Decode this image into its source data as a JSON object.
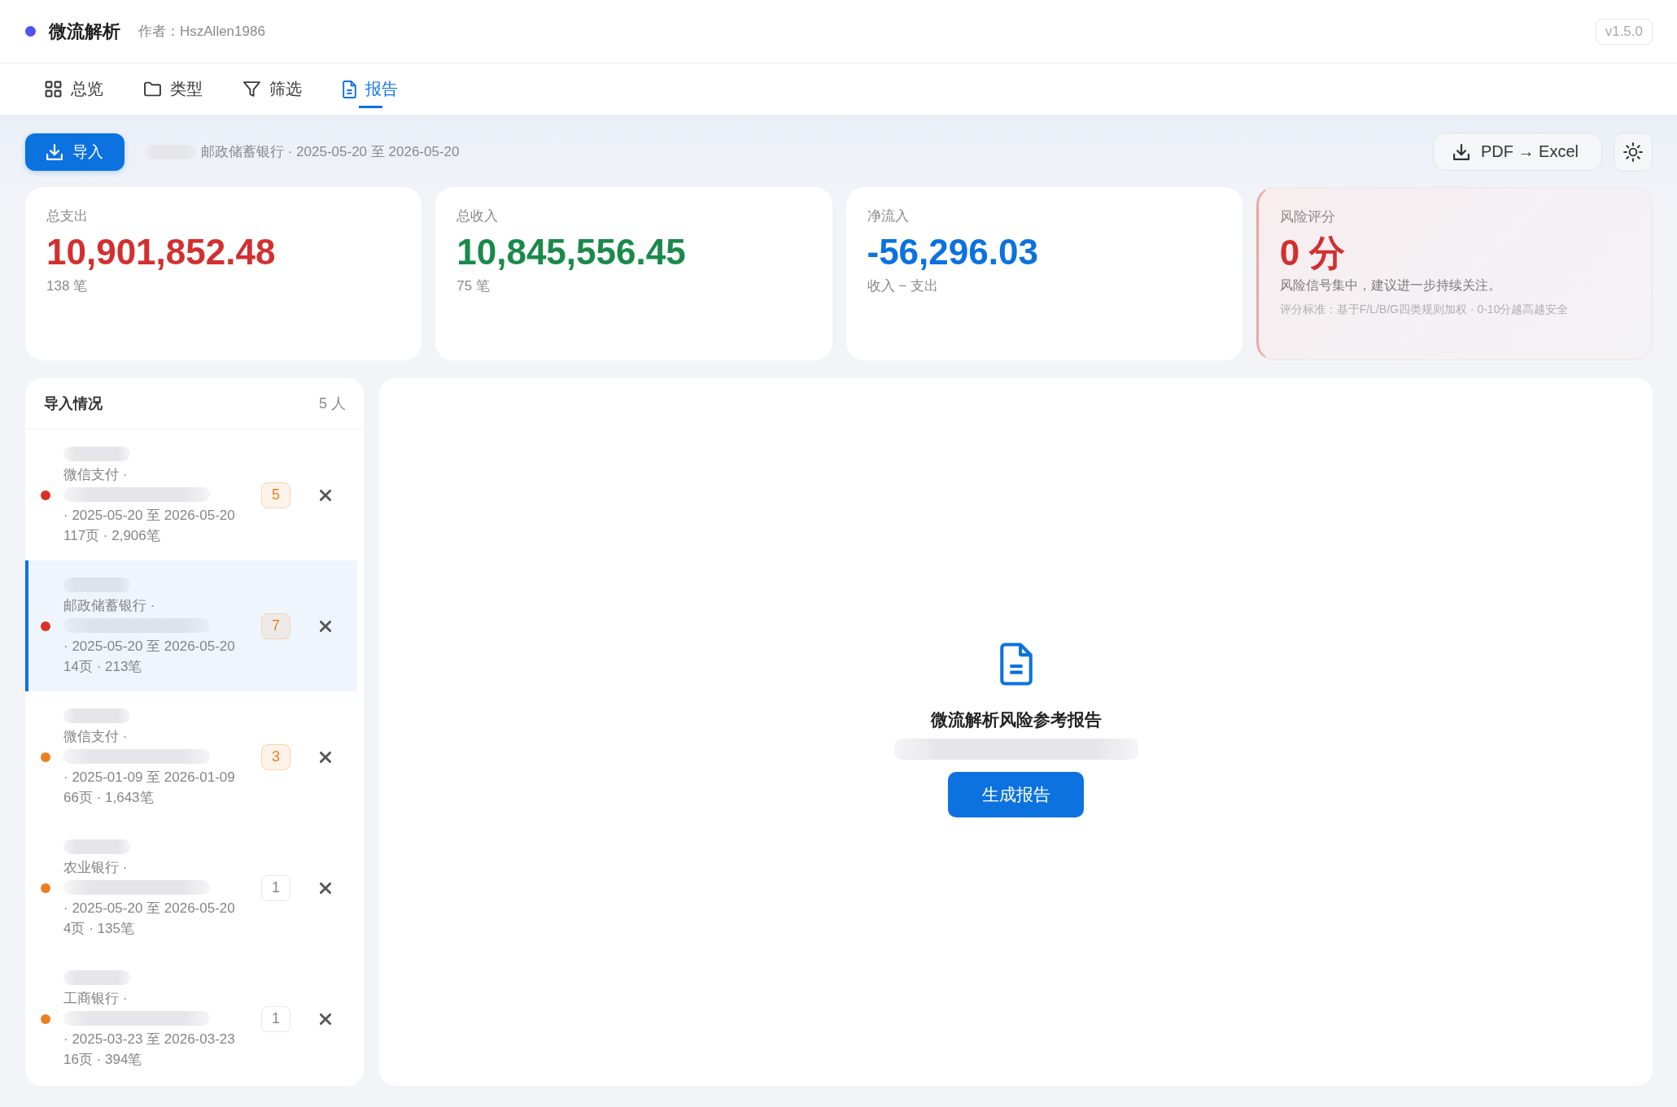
{
  "header": {
    "title": "微流解析",
    "author": "作者：HszAllen1986",
    "version": "v1.5.0"
  },
  "tabs": [
    {
      "label": "总览",
      "selected": false
    },
    {
      "label": "类型",
      "selected": false
    },
    {
      "label": "筛选",
      "selected": false
    },
    {
      "label": "报告",
      "selected": true
    }
  ],
  "toolbar": {
    "import_button": "导入",
    "current_file": "邮政储蓄银行 · 2025-05-20 至 2026-05-20",
    "convert_button": "PDF → Excel"
  },
  "stats": [
    {
      "kind": "amount",
      "label": "总支出",
      "value": "10,901,852.48",
      "color": "#d32f2f",
      "note": "138 笔"
    },
    {
      "kind": "amount",
      "label": "总收入",
      "value": "10,845,556.45",
      "color": "#1a8a4a",
      "note": "75 笔"
    },
    {
      "kind": "amount",
      "label": "净流入",
      "value": "-56,296.03",
      "color": "#0b72e0",
      "note": "收入 − 支出"
    },
    {
      "kind": "risk",
      "label": "风险评分",
      "value": "0 分",
      "color": "#d32f2f",
      "note": "风险信号集中，建议进一步持续关注。",
      "criteria": "评分标准：基于F/L/B/G四类规则加权 · 0-10分越高越安全"
    }
  ],
  "imports": {
    "title": "导入情况",
    "count": "5 人",
    "items": [
      {
        "source": "微信支付 ·",
        "period": "· 2025-05-20 至 2026-05-20",
        "stats": "117页 · 2,906笔",
        "badge": "5",
        "flagged": true,
        "color": "#d93025",
        "selected": false
      },
      {
        "source": "邮政储蓄银行 ·",
        "period": "· 2025-05-20 至 2026-05-20",
        "stats": "14页 · 213笔",
        "badge": "7",
        "flagged": true,
        "color": "#d93025",
        "selected": true
      },
      {
        "source": "微信支付 ·",
        "period": "· 2025-01-09 至 2026-01-09",
        "stats": "66页 · 1,643笔",
        "badge": "3",
        "flagged": true,
        "color": "#e8801f",
        "selected": false
      },
      {
        "source": "农业银行 ·",
        "period": "· 2025-05-20 至 2026-05-20",
        "stats": "4页 · 135笔",
        "badge": "1",
        "flagged": false,
        "color": "#e8801f",
        "selected": false
      },
      {
        "source": "工商银行 ·",
        "period": "· 2025-03-23 至 2026-03-23",
        "stats": "16页 · 394笔",
        "badge": "1",
        "flagged": false,
        "color": "#e8801f",
        "selected": false
      }
    ]
  },
  "report": {
    "title": "微流解析风险参考报告",
    "button": "生成报告"
  }
}
